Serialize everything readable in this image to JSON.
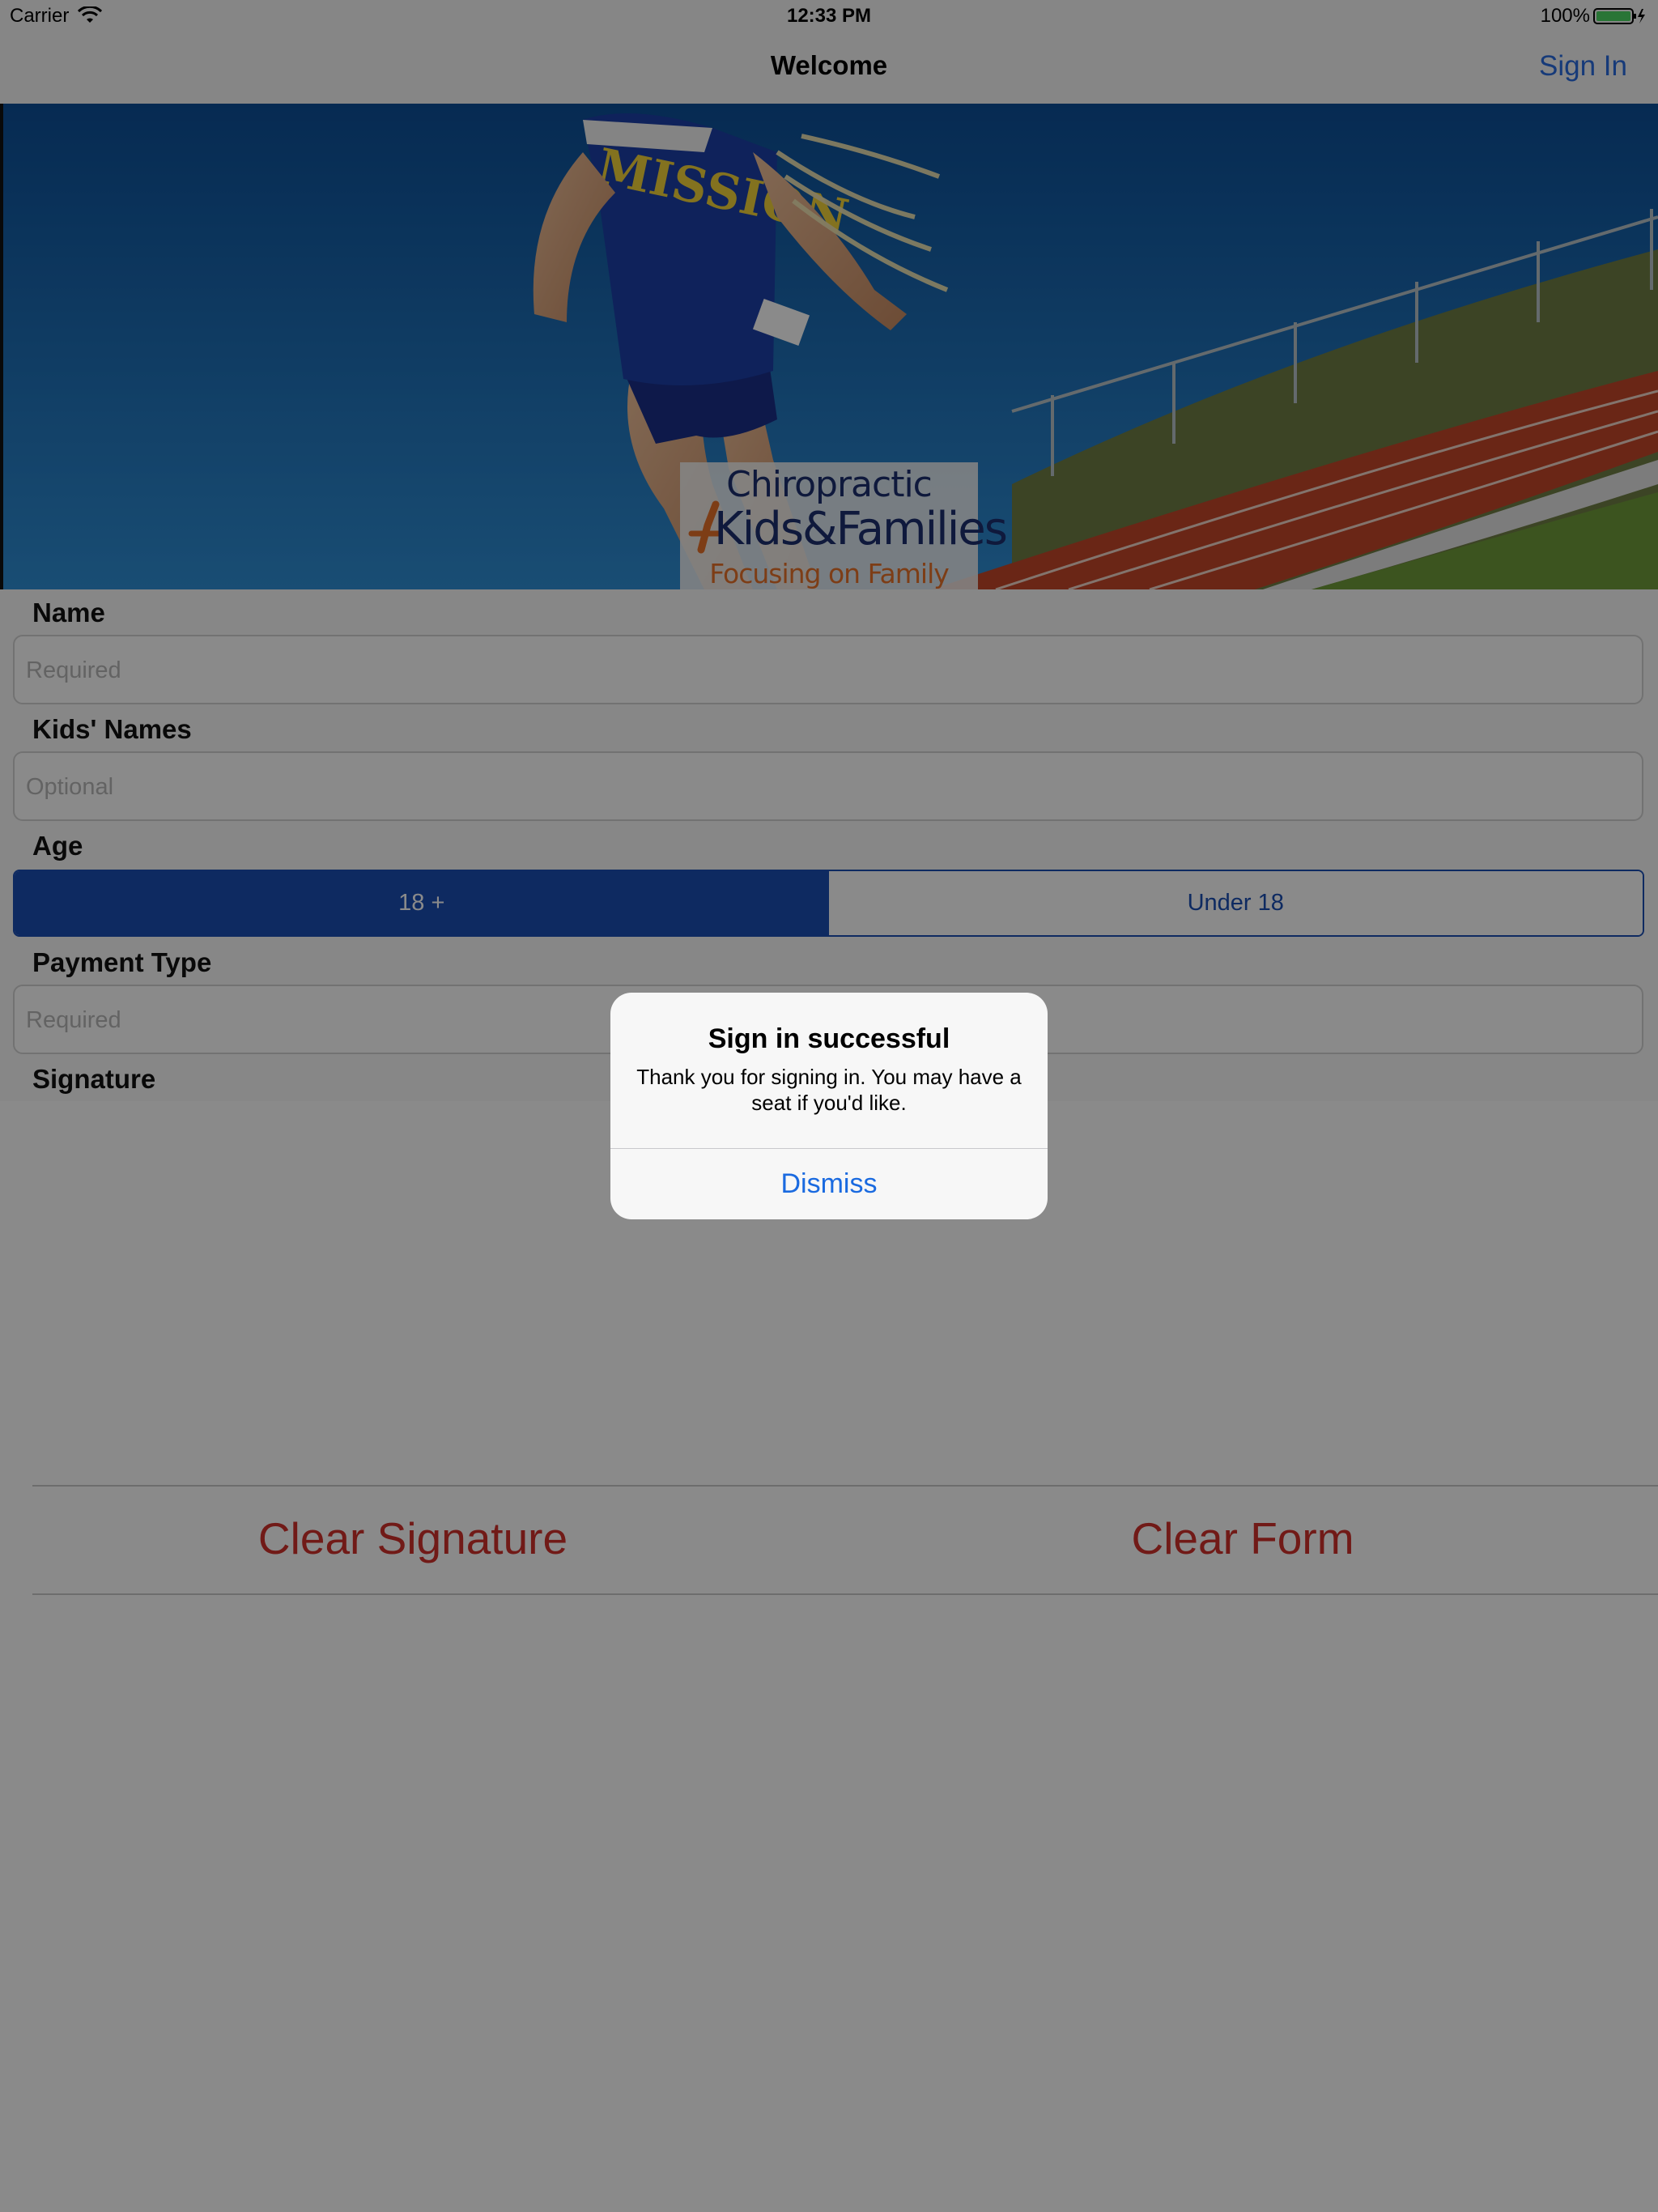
{
  "status_bar": {
    "carrier": "Carrier",
    "time": "12:33 PM",
    "battery": "100%"
  },
  "nav": {
    "title": "Welcome",
    "sign_in": "Sign In"
  },
  "hero": {
    "jersey_text": "MISSION",
    "logo": {
      "line1": "Chiropractic",
      "line2": "Kids&Families",
      "tagline": "Focusing on Family Care"
    }
  },
  "form": {
    "name": {
      "label": "Name",
      "placeholder": "Required",
      "value": ""
    },
    "kids_names": {
      "label": "Kids' Names",
      "placeholder": "Optional",
      "value": ""
    },
    "age": {
      "label": "Age",
      "options": [
        "18 +",
        "Under 18"
      ],
      "selected": "18 +"
    },
    "payment_type": {
      "label": "Payment Type",
      "placeholder": "Required",
      "value": ""
    },
    "signature": {
      "label": "Signature"
    }
  },
  "buttons": {
    "clear_signature": "Clear Signature",
    "clear_form": "Clear Form"
  },
  "alert": {
    "title": "Sign in successful",
    "message": "Thank you for signing in. You may have a seat if you'd like.",
    "button": "Dismiss"
  },
  "colors": {
    "accent": "#2a6ce0",
    "segment_selected": "#1b4eb3",
    "destructive": "#d1312c",
    "logo_navy": "#1d2f6f",
    "logo_orange": "#e7722a"
  }
}
